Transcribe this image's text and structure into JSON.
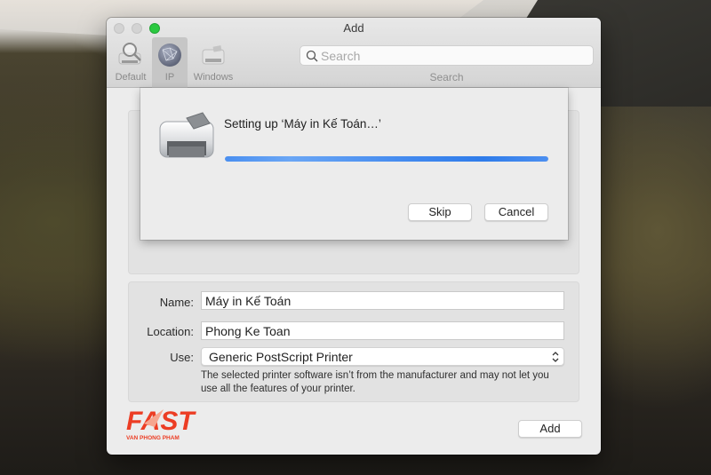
{
  "window": {
    "title": "Add",
    "traffic_lights": {
      "close_color": "#d3d3d3",
      "minimize_color": "#d3d3d3",
      "zoom_color": "#2ac940"
    }
  },
  "toolbar": {
    "items": [
      {
        "label": "Default",
        "icon": "default-printer-search-icon",
        "selected": false
      },
      {
        "label": "IP",
        "icon": "globe-network-icon",
        "selected": true
      },
      {
        "label": "Windows",
        "icon": "windows-printer-icon",
        "selected": false
      }
    ],
    "search": {
      "placeholder": "Search",
      "value": "",
      "caption": "Search"
    }
  },
  "sheet": {
    "message": "Setting up ‘Máy in Kế Toán…’",
    "progress": 1.0,
    "progress_color": "#3f87ee",
    "skip_label": "Skip",
    "cancel_label": "Cancel"
  },
  "form": {
    "name_label": "Name:",
    "name_value": "Máy in Kế Toán",
    "location_label": "Location:",
    "location_value": "Phong Ke Toan",
    "use_label": "Use:",
    "use_value": "Generic PostScript Printer",
    "note": "The selected printer software isn’t from the manufacturer and may not let you use all the features of your printer."
  },
  "footer": {
    "add_label": "Add",
    "logo_text": "FAST",
    "logo_subtext": "VAN PHONG PHAM",
    "logo_color": "#ec3d24"
  }
}
